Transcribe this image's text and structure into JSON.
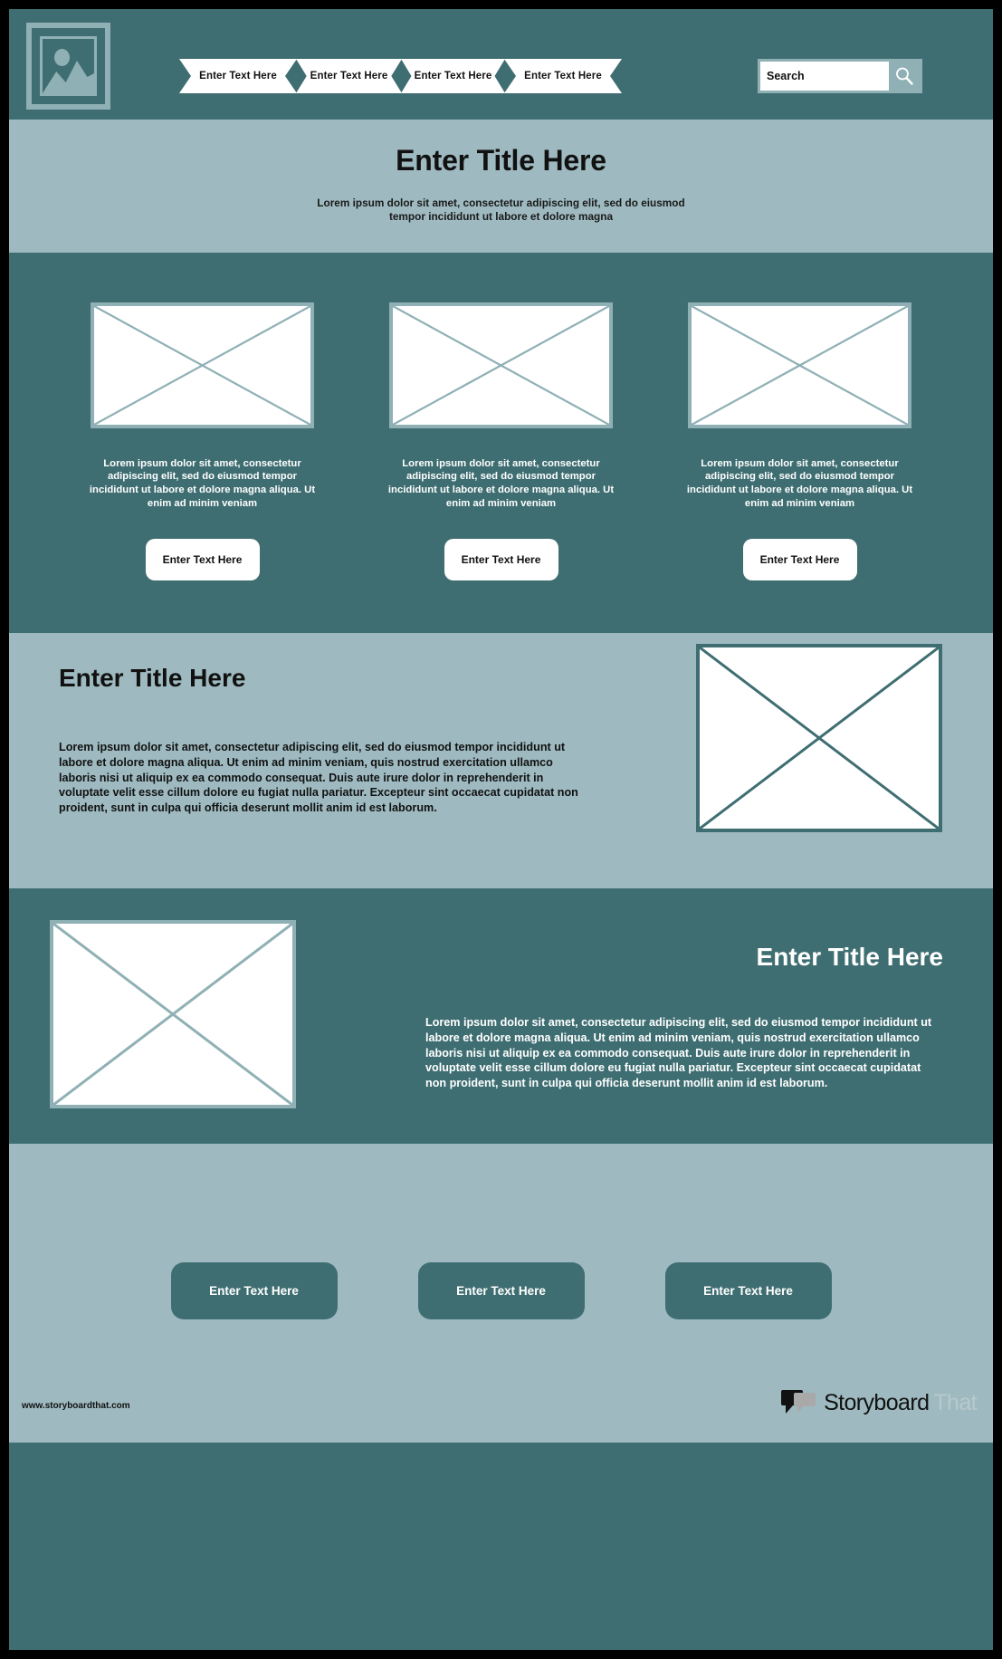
{
  "theme": {
    "dark_teal": "#3f6e72",
    "light_blue": "#9ebac0",
    "pale_border": "#8fb0b5",
    "white": "#ffffff",
    "black": "#111111"
  },
  "header": {
    "logo_icon": "image-placeholder-icon",
    "nav_items": [
      {
        "label": "Enter Text Here"
      },
      {
        "label": "Enter Text Here"
      },
      {
        "label": "Enter Text Here"
      },
      {
        "label": "Enter Text Here"
      }
    ],
    "search": {
      "value": "Search",
      "placeholder": "Search",
      "button_icon": "magnifier-icon"
    }
  },
  "hero": {
    "title": "Enter Title Here",
    "subtitle": "Lorem ipsum dolor sit amet, consectetur adipiscing elit, sed do eiusmod tempor incididunt ut labore et dolore magna"
  },
  "cards": [
    {
      "image_icon": "image-placeholder-x",
      "text": "Lorem ipsum dolor sit amet, consectetur adipiscing elit, sed do eiusmod tempor incididunt ut labore et dolore magna aliqua. Ut enim ad minim veniam",
      "button_label": "Enter Text Here"
    },
    {
      "image_icon": "image-placeholder-x",
      "text": "Lorem ipsum dolor sit amet, consectetur adipiscing elit, sed do eiusmod tempor incididunt ut labore et dolore magna aliqua. Ut enim ad minim veniam",
      "button_label": "Enter Text Here"
    },
    {
      "image_icon": "image-placeholder-x",
      "text": "Lorem ipsum dolor sit amet, consectetur adipiscing elit, sed do eiusmod tempor incididunt ut labore et dolore magna aliqua. Ut enim ad minim veniam",
      "button_label": "Enter Text Here"
    }
  ],
  "feature_light": {
    "title": "Enter Title Here",
    "body": "Lorem ipsum dolor sit amet, consectetur adipiscing elit, sed do eiusmod tempor incididunt ut labore et dolore magna aliqua. Ut enim ad minim veniam, quis nostrud exercitation ullamco laboris nisi ut aliquip ex ea commodo consequat. Duis aute irure dolor in reprehenderit in voluptate velit esse cillum dolore eu fugiat nulla pariatur. Excepteur sint occaecat cupidatat non proident, sunt in culpa qui officia deserunt mollit anim id est laborum.",
    "image_icon": "image-placeholder-x"
  },
  "feature_dark": {
    "title": "Enter Title Here",
    "body": "Lorem ipsum dolor sit amet, consectetur adipiscing elit, sed do eiusmod tempor incididunt ut labore et dolore magna aliqua. Ut enim ad minim veniam, quis nostrud exercitation ullamco laboris nisi ut aliquip ex ea commodo consequat. Duis aute irure dolor in reprehenderit in voluptate velit esse cillum dolore eu fugiat nulla pariatur. Excepteur sint occaecat cupidatat non proident, sunt in culpa qui officia deserunt mollit anim id est laborum.",
    "image_icon": "image-placeholder-x"
  },
  "cta": {
    "buttons": [
      {
        "label": "Enter Text Here"
      },
      {
        "label": "Enter Text Here"
      },
      {
        "label": "Enter Text Here"
      }
    ]
  },
  "footer": {
    "url": "www.storyboardthat.com",
    "brand_primary": "Storyboard",
    "brand_secondary": "That",
    "brand_icon": "speech-bubbles-icon"
  }
}
